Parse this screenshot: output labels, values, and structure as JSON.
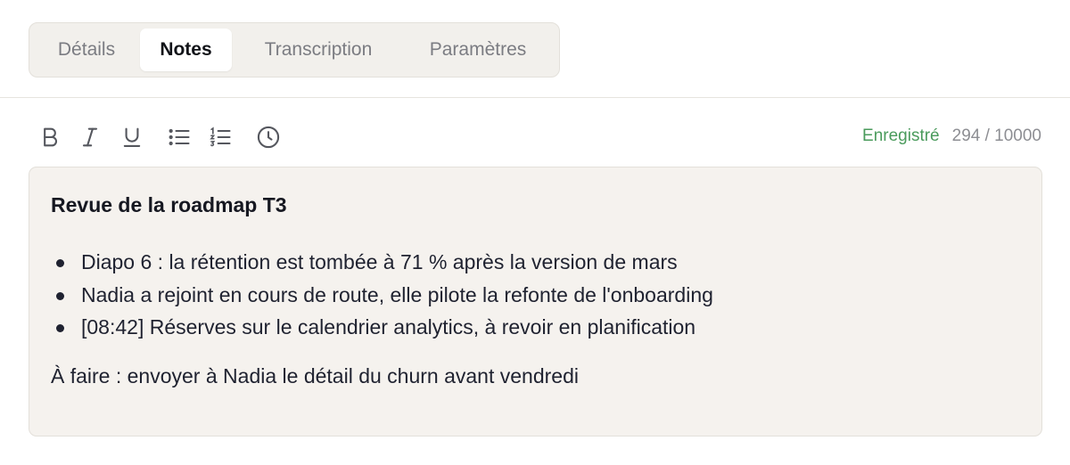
{
  "tabs": [
    {
      "label": "Détails",
      "active": false
    },
    {
      "label": "Notes",
      "active": true
    },
    {
      "label": "Transcription",
      "active": false
    },
    {
      "label": "Paramètres",
      "active": false
    }
  ],
  "toolbar": {
    "tools": [
      "bold-icon",
      "italic-icon",
      "underline-icon",
      "bulleted-list-icon",
      "numbered-list-icon",
      "clock-icon"
    ],
    "saved_label": "Enregistré",
    "char_count": "294 / 10000"
  },
  "note": {
    "title": "Revue de la roadmap T3",
    "bullets": [
      "Diapo 6 : la rétention est tombée à 71 % après la version de mars",
      "Nadia a rejoint en cours de route, elle pilote la refonte de l'onboarding",
      "[08:42] Réserves sur le calendrier analytics, à revoir en planification"
    ],
    "todo": "À faire : envoyer à Nadia le détail du churn avant vendredi"
  },
  "colors": {
    "saved": "#4a9b5c",
    "editor_bg": "#f5f2ee",
    "tabbar_bg": "#f2f0ec"
  }
}
